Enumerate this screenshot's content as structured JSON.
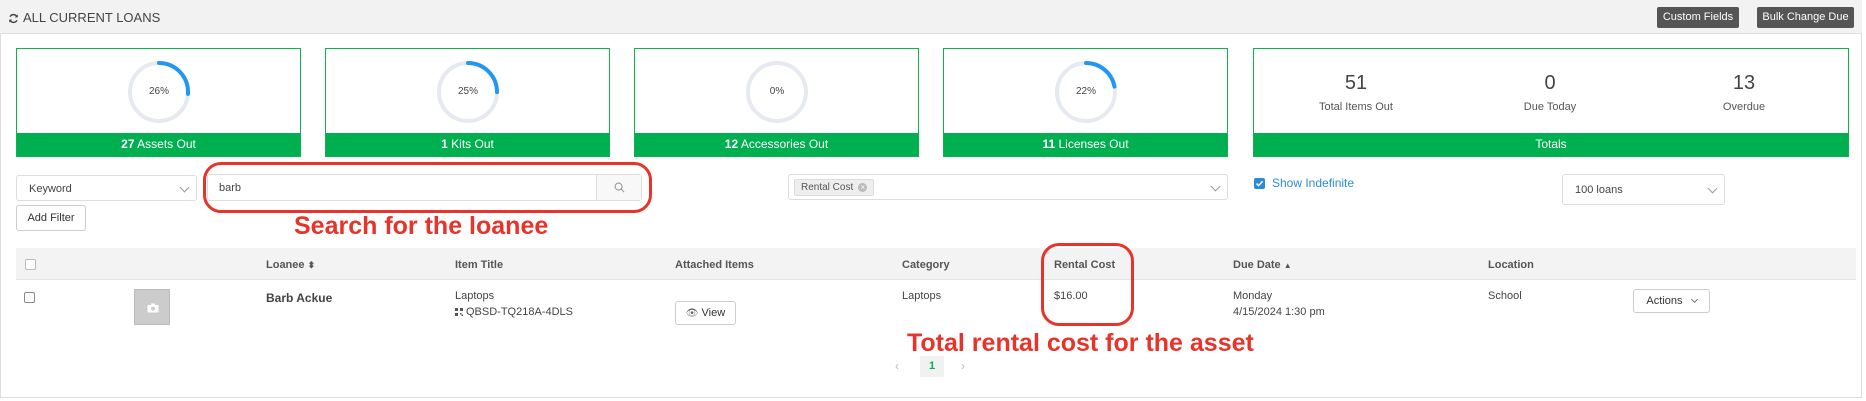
{
  "header": {
    "title": "ALL CURRENT LOANS",
    "custom_fields_label": "Custom Fields",
    "bulk_change_due_label": "Bulk Change Due"
  },
  "stats": [
    {
      "percent": 26,
      "percent_label": "26%",
      "count": "27",
      "label": "Assets Out"
    },
    {
      "percent": 25,
      "percent_label": "25%",
      "count": "1",
      "label": "Kits Out"
    },
    {
      "percent": 0,
      "percent_label": "0%",
      "count": "12",
      "label": "Accessories Out"
    },
    {
      "percent": 22,
      "percent_label": "22%",
      "count": "11",
      "label": "Licenses Out"
    }
  ],
  "totals": {
    "items_out": "51",
    "items_out_label": "Total Items Out",
    "due_today": "0",
    "due_today_label": "Due Today",
    "overdue": "13",
    "overdue_label": "Overdue",
    "footer": "Totals"
  },
  "filters": {
    "keyword_select": "Keyword",
    "search_value": "barb",
    "add_filter": "Add Filter",
    "column_tag": "Rental Cost",
    "show_indefinite": "Show Indefinite",
    "show_indefinite_checked": true,
    "page_size": "100 loans"
  },
  "table": {
    "headers": {
      "loanee": "Loanee",
      "item_title": "Item Title",
      "attached_items": "Attached Items",
      "category": "Category",
      "rental_cost": "Rental Cost",
      "due_date": "Due Date",
      "location": "Location"
    },
    "rows": [
      {
        "loanee": "Barb Ackue",
        "item_title": "Laptops",
        "item_code": "QBSD-TQ218A-4DLS",
        "view_label": "View",
        "category": "Laptops",
        "rental_cost": "$16.00",
        "due_day": "Monday",
        "due_datetime": "4/15/2024 1:30 pm",
        "location": "School",
        "actions_label": "Actions"
      }
    ]
  },
  "pagination": {
    "current_page": "1"
  },
  "annotations": {
    "search": "Search for the loanee",
    "rental": "Total rental cost for the asset"
  },
  "colors": {
    "accent_green": "#00b050",
    "gauge_blue": "#2196f3",
    "annotation_red": "#e8332a",
    "link_blue": "#2b8bd8"
  }
}
